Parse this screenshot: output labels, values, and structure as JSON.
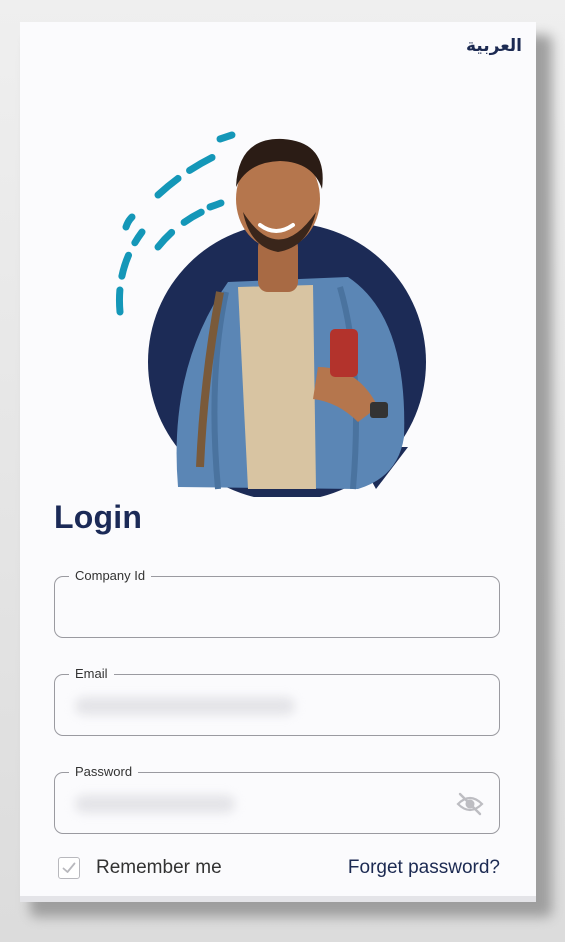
{
  "header": {
    "language_toggle": "العربية"
  },
  "login": {
    "title": "Login"
  },
  "fields": {
    "company_id": {
      "label": "Company Id",
      "value": ""
    },
    "email": {
      "label": "Email",
      "value": ""
    },
    "password": {
      "label": "Password",
      "value": ""
    }
  },
  "options": {
    "remember_me_label": "Remember me",
    "remember_me_checked": true,
    "forget_password_label": "Forget password?"
  },
  "colors": {
    "brand_navy": "#1b2a57",
    "accent_teal": "#1497b8",
    "background": "#fbfbfd"
  },
  "icons": {
    "password_visibility": "eye-off-icon",
    "checkbox": "check-icon"
  }
}
